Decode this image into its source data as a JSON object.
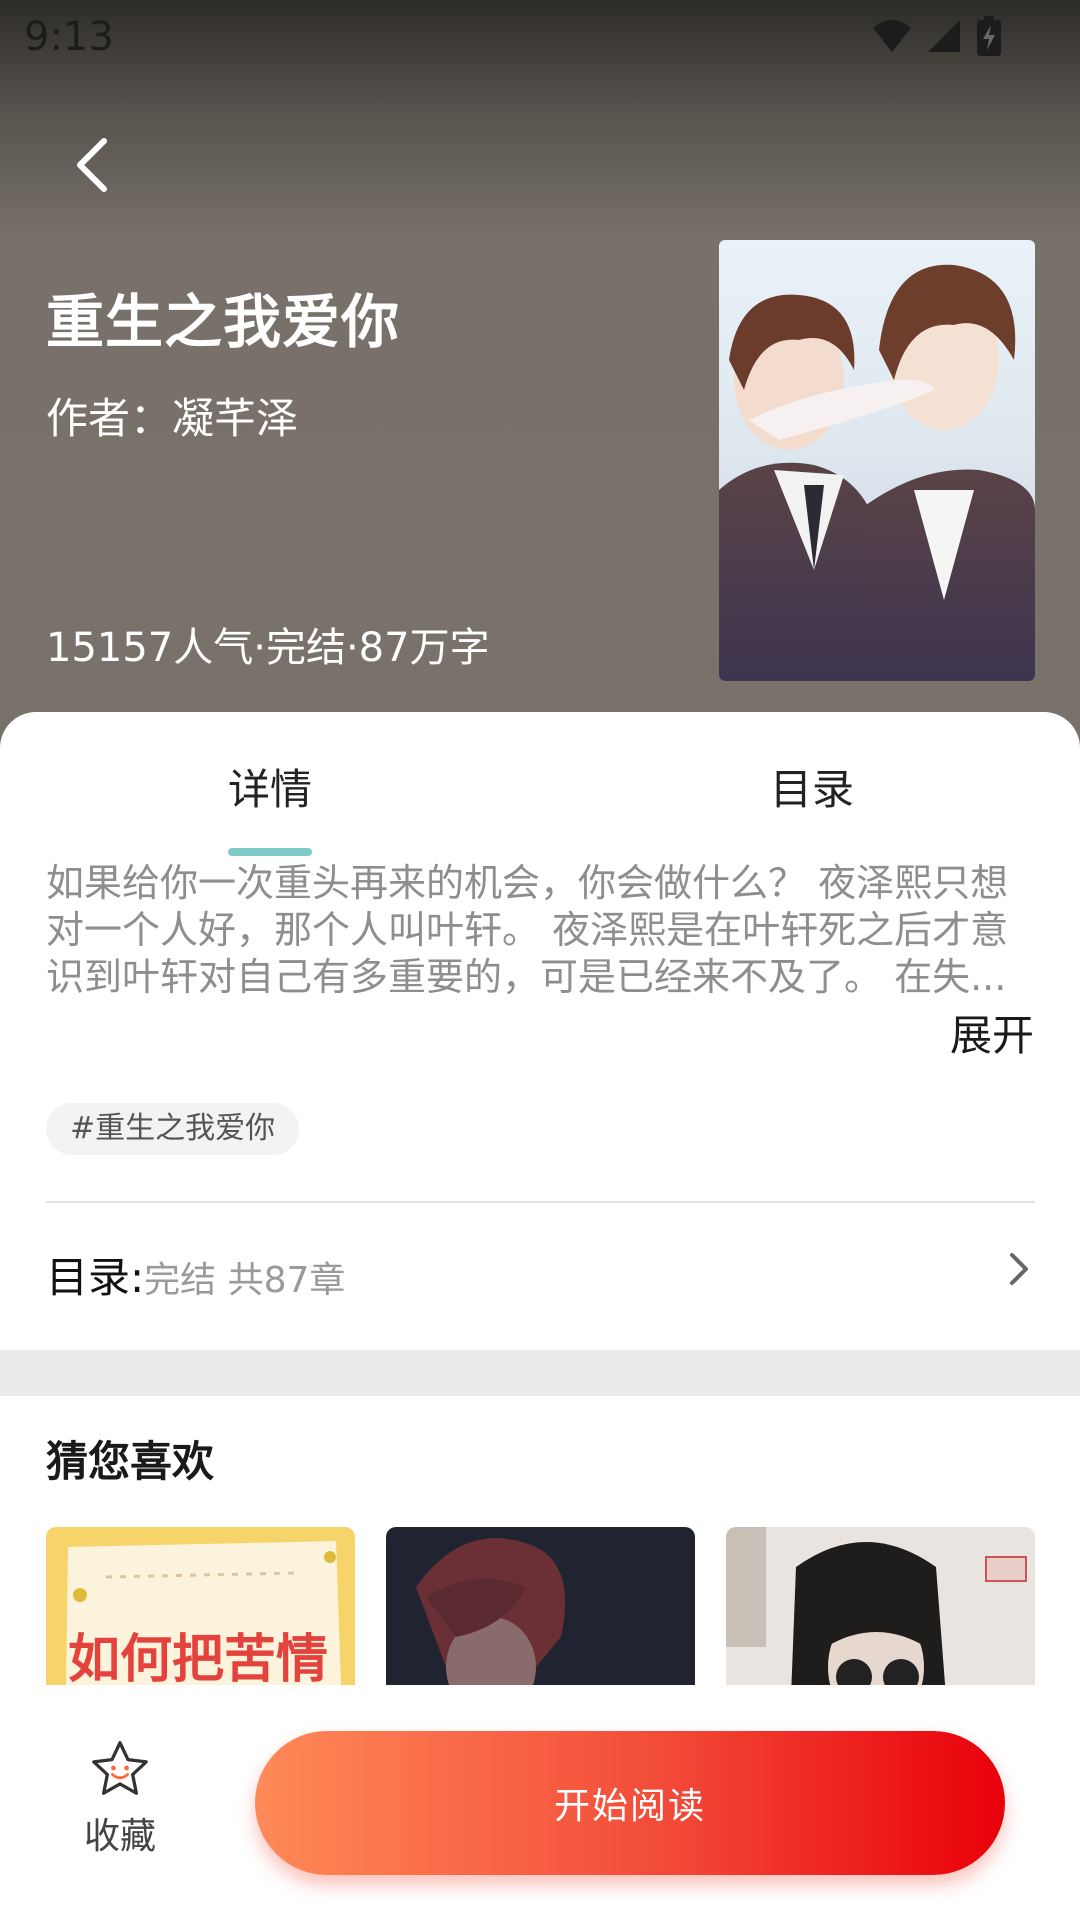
{
  "status_bar": {
    "time": "9:13"
  },
  "book": {
    "title": "重生之我爱你",
    "author": "作者：凝芊泽",
    "stats": "15157人气·完结·87万字"
  },
  "tabs": [
    {
      "label": "详情",
      "selected": true
    },
    {
      "label": "目录",
      "selected": false
    }
  ],
  "synopsis": "如果给你一次重头再来的机会，你会做什么？ 夜泽熙只想对一个人好，那个人叫叶轩。 夜泽熙是在叶轩死之后才意识到叶轩对自己有多重要的，可是已经来不及了。 在失...",
  "expand_label": "展开",
  "tag": "#重生之我爱你",
  "toc": {
    "label": "目录:",
    "info": "完结 共87章"
  },
  "recommend": {
    "title": "猜您喜欢",
    "items": [
      {
        "cover_text": "如何把苦情"
      },
      {
        "cover_text": ""
      },
      {
        "cover_text": ""
      }
    ]
  },
  "bottom": {
    "favorite_label": "收藏",
    "read_label": "开始阅读"
  },
  "colors": {
    "accent_teal": "#7fcbc5",
    "read_start": "#ff8a58",
    "read_end": "#e9000a",
    "header_bg": "#79726a"
  },
  "icons": [
    "back-icon",
    "wifi-icon",
    "signal-icon",
    "battery-icon",
    "chevron-right-icon",
    "star-icon"
  ]
}
